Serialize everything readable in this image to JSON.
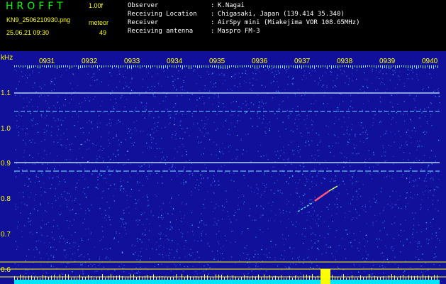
{
  "header": {
    "app_title": "HROFFT",
    "version": "1.00f",
    "filename": "KN9_2506210930.png",
    "mode": "meteor",
    "count": "49",
    "datetime": "25.06.21 09:30"
  },
  "station_info": [
    {
      "label": "Observer",
      "value": "K.Nagai"
    },
    {
      "label": "Receiving Location",
      "value": "Chigasaki, Japan (139.414 35.340)"
    },
    {
      "label": "Receiver",
      "value": "AirSpy mini (Miakejima VOR 108.65MHz)"
    },
    {
      "label": "Receiving antenna",
      "value": "Maspro FM-3"
    }
  ],
  "spectrogram": {
    "unit_label": "kHz",
    "time_ticks": [
      "0931",
      "0932",
      "0933",
      "0934",
      "0935",
      "0936",
      "0937",
      "0938",
      "0939",
      "0940"
    ],
    "freq_ticks": [
      "1.1",
      "1.0",
      "0.9",
      "0.8",
      "0.7",
      "0.6"
    ],
    "colors": {
      "background": "#10109a",
      "text": "#ffff00",
      "baseline": "#00e5ff",
      "signal": "#ffff00"
    }
  }
}
